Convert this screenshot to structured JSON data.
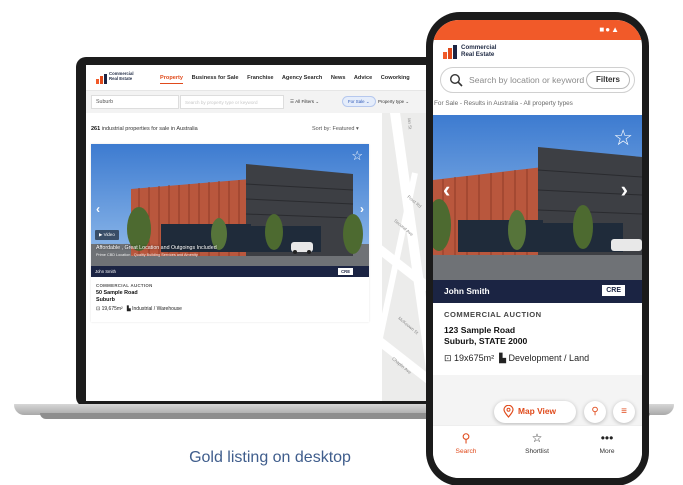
{
  "caption": "Gold listing on desktop",
  "colors": {
    "brand_orange": "#f15a29",
    "navy": "#1b2443",
    "caption_blue": "#3f5d8c"
  },
  "desktop": {
    "logo": {
      "line1": "Commercial",
      "line2": "Real Estate"
    },
    "nav": [
      "Property",
      "Business for Sale",
      "Franchise",
      "Agency Search",
      "News",
      "Advice",
      "Coworking"
    ],
    "filters": {
      "suburb": "Suburb",
      "search_placeholder": "Search by property type or keyword",
      "all_filters": "All Filters",
      "for_sale": "For Sale",
      "property_type": "Property type"
    },
    "results": {
      "count": "261",
      "count_text": "industrial properties for sale in Australia",
      "sort": "Sort by: Featured"
    },
    "map_labels": [
      "Ian St",
      "Frost Rd",
      "Second Ave",
      "McKeown St",
      "Chaplin Ave"
    ],
    "listing": {
      "video": "Video",
      "headline": "Affordable , Great Location and Outgoings Included",
      "subline": "Prime CBD Location - Quality Building Services and Amenity",
      "agent": "John Smith",
      "badge": "CRE",
      "label": "COMMERCIAL AUCTION",
      "address1": "50 Sample Road",
      "address2": "Suburb",
      "area": "19,675m²",
      "type": "Industrial / Warehouse"
    }
  },
  "mobile": {
    "logo": {
      "line1": "Commercial",
      "line2": "Real Estate"
    },
    "search_placeholder": "Search by location or keyword",
    "filters_button": "Filters",
    "results_text": "For Sale - Results in Australia - All property types",
    "listing": {
      "agent": "John Smith",
      "badge": "CRE",
      "label": "COMMERCIAL AUCTION",
      "address1": "123 Sample Road",
      "address2": "Suburb, STATE 2000",
      "area": "19x675m²",
      "type": "Development / Land"
    },
    "map_view": "Map View",
    "tabs": [
      {
        "label": "Search",
        "icon": "search-icon"
      },
      {
        "label": "Shortlist",
        "icon": "star-icon"
      },
      {
        "label": "More",
        "icon": "more-icon"
      }
    ]
  }
}
